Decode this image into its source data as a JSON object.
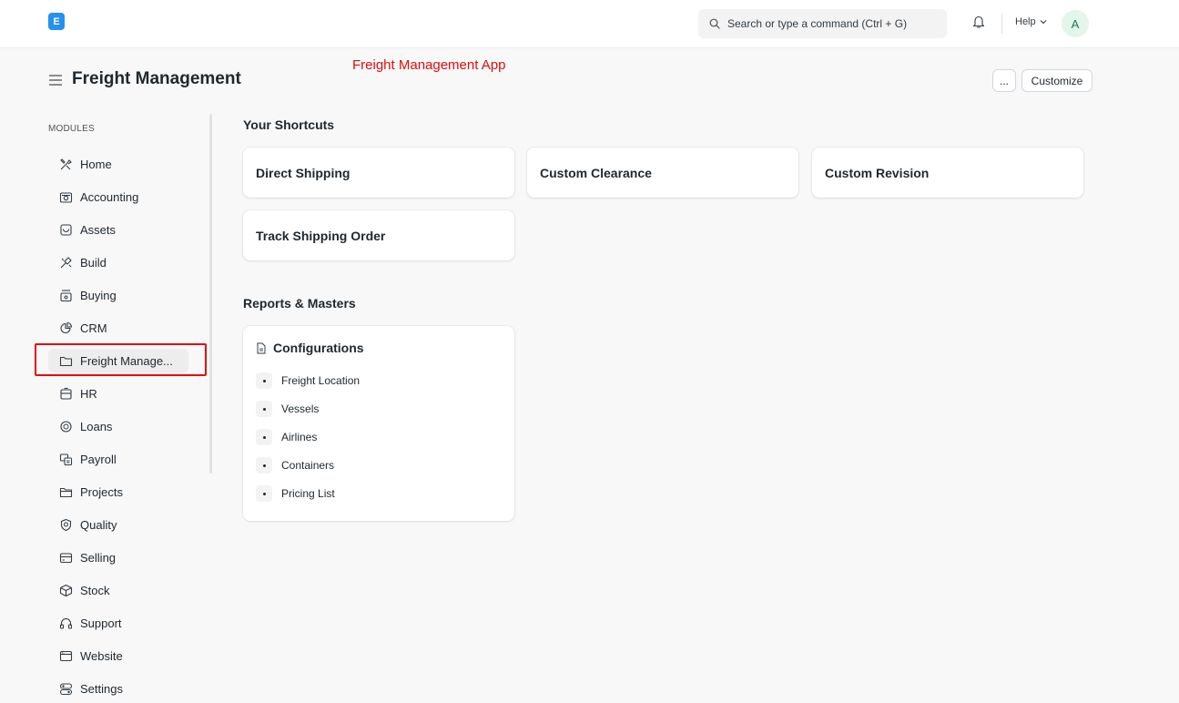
{
  "navbar": {
    "logo_letter": "E",
    "search_placeholder": "Search or type a command (Ctrl + G)",
    "help_label": "Help",
    "avatar_initial": "A"
  },
  "header": {
    "title": "Freight Management",
    "annotation": "Freight Management App",
    "more_label": "...",
    "customize_label": "Customize"
  },
  "sidebar": {
    "section_label": "MODULES",
    "items": [
      {
        "label": "Home",
        "icon": "tools-icon"
      },
      {
        "label": "Accounting",
        "icon": "accounting-icon"
      },
      {
        "label": "Assets",
        "icon": "assets-icon"
      },
      {
        "label": "Build",
        "icon": "build-icon"
      },
      {
        "label": "Buying",
        "icon": "buying-icon"
      },
      {
        "label": "CRM",
        "icon": "crm-icon"
      },
      {
        "label": "Freight Manage...",
        "icon": "folder-icon",
        "active": true
      },
      {
        "label": "HR",
        "icon": "hr-icon"
      },
      {
        "label": "Loans",
        "icon": "loans-icon"
      },
      {
        "label": "Payroll",
        "icon": "payroll-icon"
      },
      {
        "label": "Projects",
        "icon": "projects-icon"
      },
      {
        "label": "Quality",
        "icon": "quality-icon"
      },
      {
        "label": "Selling",
        "icon": "selling-icon"
      },
      {
        "label": "Stock",
        "icon": "stock-icon"
      },
      {
        "label": "Support",
        "icon": "support-icon"
      },
      {
        "label": "Website",
        "icon": "website-icon"
      },
      {
        "label": "Settings",
        "icon": "settings-icon"
      }
    ]
  },
  "shortcuts": {
    "title": "Your Shortcuts",
    "items": [
      "Direct Shipping",
      "Custom Clearance",
      "Custom Revision",
      "Track Shipping Order"
    ]
  },
  "reports": {
    "title": "Reports & Masters",
    "card_title": "Configurations",
    "links": [
      "Freight Location",
      "Vessels",
      "Airlines",
      "Containers",
      "Pricing List"
    ]
  },
  "colors": {
    "accent": "#2490ef",
    "annotation": "#e40c0c",
    "avatar_bg": "#e4f5e9",
    "avatar_fg": "#16794c"
  }
}
